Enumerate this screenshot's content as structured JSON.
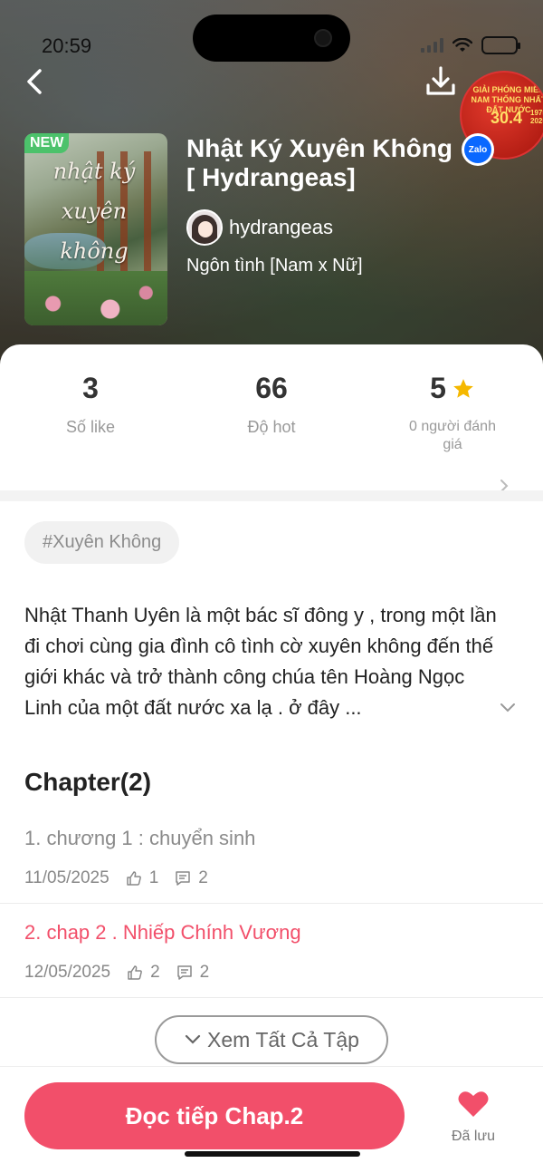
{
  "status_bar": {
    "time": "20:59"
  },
  "promo": {
    "line1": "GIẢI PHÓNG MIỀN NAM THỐNG NHẤT ĐẤT NƯỚC",
    "date": "30.4",
    "years": "1975 2025"
  },
  "story": {
    "badge": "NEW",
    "cover_title": "nhật ký xuyên không",
    "title": "Nhật Ký Xuyên Không [ Hydrangeas]",
    "author": "hydrangeas",
    "genre": "Ngôn tình [Nam x Nữ]"
  },
  "stats": {
    "likes": {
      "value": "3",
      "label": "Số like"
    },
    "hot": {
      "value": "66",
      "label": "Độ hot"
    },
    "rating": {
      "value": "5",
      "label": "0 người đánh giá"
    }
  },
  "tag": "#Xuyên Không",
  "summary": "Nhật Thanh Uyên là một bác sĩ đông y , trong một lần đi chơi cùng gia đình cô tình cờ xuyên không đến thế giới khác và trở thành công chúa tên Hoàng Ngọc Linh của một đất nước xa lạ . ở đây ...",
  "chapters_heading": "Chapter(2)",
  "chapters": [
    {
      "title": "1. chương 1 : chuyển sinh",
      "date": "11/05/2025",
      "likes": "1",
      "comments": "2"
    },
    {
      "title": "2. chap 2 . Nhiếp Chính Vương",
      "date": "12/05/2025",
      "likes": "2",
      "comments": "2"
    }
  ],
  "see_all_label": "Xem Tất Cả Tập",
  "read_button_label": "Đọc tiếp Chap.2",
  "saved_label": "Đã lưu",
  "colors": {
    "accent": "#f24f6a",
    "new_badge": "#4cc26b",
    "star": "#f5b800",
    "zalo": "#0a68ff"
  }
}
